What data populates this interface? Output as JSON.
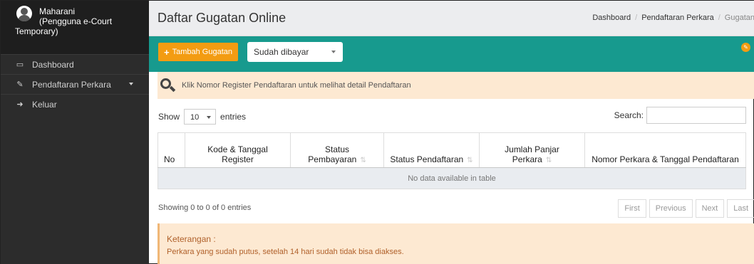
{
  "sidebar": {
    "user_name": "Maharani",
    "user_role": "(Pengguna e-Court Temporary)",
    "items": [
      {
        "label": "Dashboard",
        "icon": "monitor-icon"
      },
      {
        "label": "Pendaftaran Perkara",
        "icon": "edit-icon"
      },
      {
        "label": "Keluar",
        "icon": "sign-out-icon"
      }
    ]
  },
  "header": {
    "title": "Daftar Gugatan Online",
    "breadcrumb": [
      "Dashboard",
      "Pendaftaran Perkara",
      "Gugatan"
    ]
  },
  "toolbar": {
    "add_label": "Tambah Gugatan",
    "status_value": "Sudah dibayar",
    "accent": "#179a8e",
    "button_color": "#f39c12"
  },
  "info": {
    "text": "Klik Nomor Register Pendaftaran untuk melihat detail Pendaftaran"
  },
  "datatable": {
    "show_label": "Show",
    "length_value": "10",
    "entries_label": "entries",
    "search_label": "Search:",
    "columns": [
      "No",
      "Kode & Tanggal Register",
      "Status Pembayaran",
      "Status Pendaftaran",
      "Jumlah Panjar Perkara",
      "Nomor Perkara & Tanggal Pendaftaran"
    ],
    "empty_text": "No data available in table",
    "info_text": "Showing 0 to 0 of 0 entries",
    "pager": [
      "First",
      "Previous",
      "Next",
      "Last"
    ]
  },
  "note": {
    "title": "Keterangan :",
    "text": "Perkara yang sudah putus, setelah 14 hari sudah tidak bisa diakses."
  }
}
